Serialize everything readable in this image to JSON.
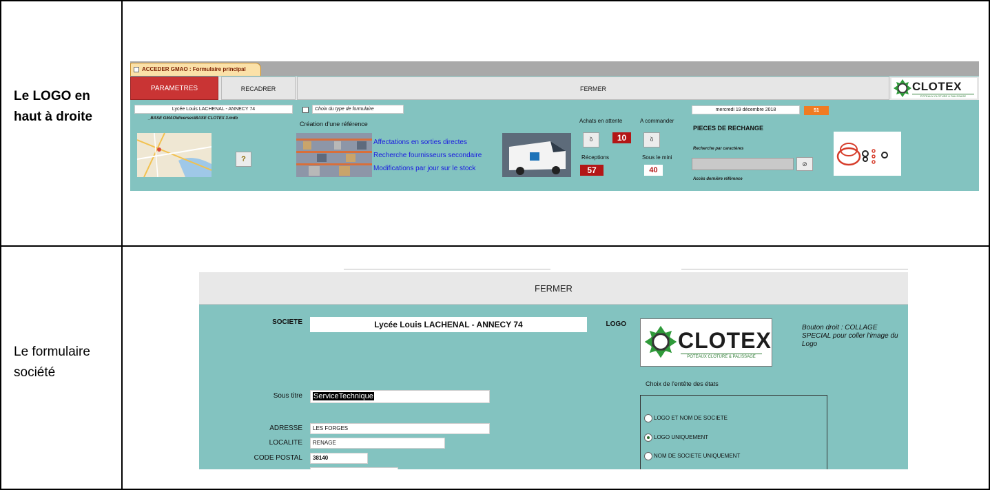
{
  "document": {
    "row1_label": "Le LOGO en haut à droite",
    "row2_label": "Le formulaire société"
  },
  "screen1": {
    "tab_title": "ACCEDER GMAO : Formulaire principal",
    "buttons": {
      "parametres": "PARAMETRES",
      "recadrer": "RECADRER",
      "fermer": "FERMER"
    },
    "logo": {
      "name": "CLOTEX",
      "tagline": "POTEAUX CLOTURE & PALISSAGE"
    },
    "company_field": "Lycée Louis LACHENAL - ANNECY 74",
    "db_path": "_BASE GMAO\\diverses\\BASE CLOTEX 3.mdb",
    "choix_type_label": "Choix du type de formulaire",
    "creation_reference": "Création d'une référence",
    "links": [
      "Affectations en sorties directes",
      "Recherche fournisseurs secondaire",
      "Modifications par jour sur le stock"
    ],
    "achats_en_attente_label": "Achats en attente",
    "achats_en_attente_value": "10",
    "a_commander_label": "A commander",
    "receptions_label": "Réceptions",
    "receptions_value": "57",
    "sous_le_mini_label": "Sous le mini",
    "sous_le_mini_value": "40",
    "date": "mercredi 19 décembre 2018",
    "week": "51",
    "pieces_de_rechange": "PIECES DE RECHANGE",
    "recherche_caracteres": "Recherche par caractères",
    "acces_derniere_reference": "Accès dernière référence",
    "icons": [
      "binoculars-icon",
      "key-icon",
      "search-icon"
    ]
  },
  "screen2": {
    "fermer": "FERMER",
    "societe_label": "SOCIETE",
    "societe_value": "Lycée Louis LACHENAL - ANNECY 74",
    "logo_label": "LOGO",
    "logo": {
      "name": "CLOTEX",
      "tagline": "POTEAUX CLOTURE & PALISSAGE"
    },
    "note": "Bouton droit : COLLAGE SPECIAL pour coller  l'image du Logo",
    "sous_titre_label": "Sous titre",
    "sous_titre_value": "ServiceTechnique",
    "adresse_label": "ADRESSE",
    "adresse_value": "LES FORGES",
    "localite_label": "LOCALITE",
    "localite_value": "RENAGE",
    "code_postal_label": "CODE POSTAL",
    "code_postal_value": "38140",
    "choix_entete": "Choix de l'entête des états",
    "radio_options": [
      {
        "label": "LOGO ET NOM DE SOCIETE",
        "selected": false
      },
      {
        "label": "LOGO UNIQUEMENT",
        "selected": true
      },
      {
        "label": "NOM DE SOCIETE UNIQUEMENT",
        "selected": false
      }
    ]
  },
  "colors": {
    "form_background": "#83c3c0",
    "parametres_button": "#c93434",
    "counter_red": "#b31616",
    "week_badge": "#f07b22",
    "link_blue": "#1a1ae0",
    "logo_green": "#2f7d35"
  }
}
